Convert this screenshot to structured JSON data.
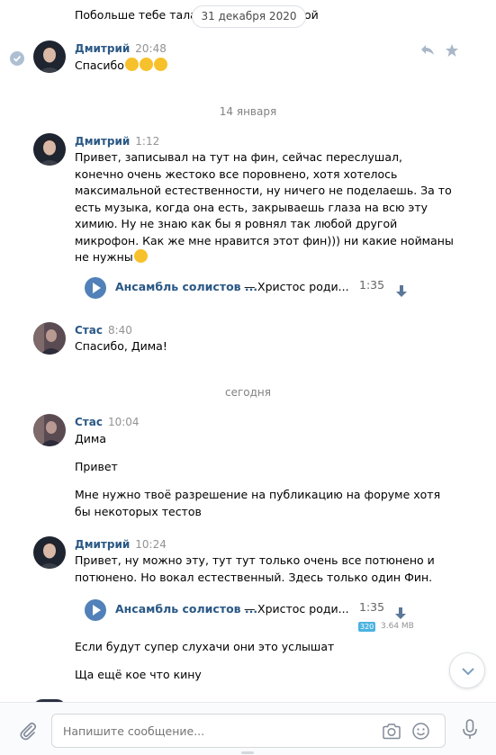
{
  "messages": {
    "prev_text": "Побольше тебе таланта",
    "prev_text_tail": "ой",
    "date_pill": "31 декабря 2020",
    "m1": {
      "author": "Дмитрий",
      "time": "20:48",
      "text": "Спасибо"
    },
    "sep1": "14 января",
    "m2": {
      "author": "Дмитрий",
      "time": "1:12",
      "lines": [
        "Привет, записывал на тут на фин, сейчас переслушал,",
        "конечно очень жестоко все поровнено, хотя хотелось",
        "максимальной естественности, ну ничего не поделаешь. За то",
        "есть музыка, когда она есть, закрываешь глаза на всю эту",
        "химию. Ну не знаю как бы я ровнял так любой другой",
        "микрофон. Как же мне нравится этот фин))) ни какие нойманы",
        "не нужны"
      ],
      "audio": {
        "artist": "Ансамбль солистов ...",
        "dash": "—",
        "title": "Христос роди...",
        "duration": "1:35"
      }
    },
    "m3": {
      "author": "Стас",
      "time": "8:40",
      "text": "Спасибо, Дима!"
    },
    "sep2": "сегодня",
    "m4": {
      "author": "Стас",
      "time": "10:04",
      "texts": [
        "Дима",
        "Привет"
      ],
      "para": [
        "Мне нужно твоё разрешение на публикацию на форуме хотя",
        "бы некоторых тестов"
      ]
    },
    "m5": {
      "author": "Дмитрий",
      "time": "10:24",
      "lines": [
        "Привет, ну можно эту, тут тут только очень все потюнено и",
        "потюнено. Но вокал естественный. Здесь только один Фин."
      ],
      "audio": {
        "artist": "Ансамбль солистов ...",
        "dash": "—",
        "title": "Христос роди...",
        "duration": "1:35",
        "bitrate": "320",
        "size": "3.64 MB"
      },
      "after": [
        "Если будут супер слухачи они это услышат",
        "Ща ещё кое что кину"
      ]
    }
  },
  "composer": {
    "placeholder": "Напишите сообщение..."
  },
  "colors": {
    "accent": "#5181b8",
    "link": "#2a5885",
    "muted": "#939393"
  }
}
